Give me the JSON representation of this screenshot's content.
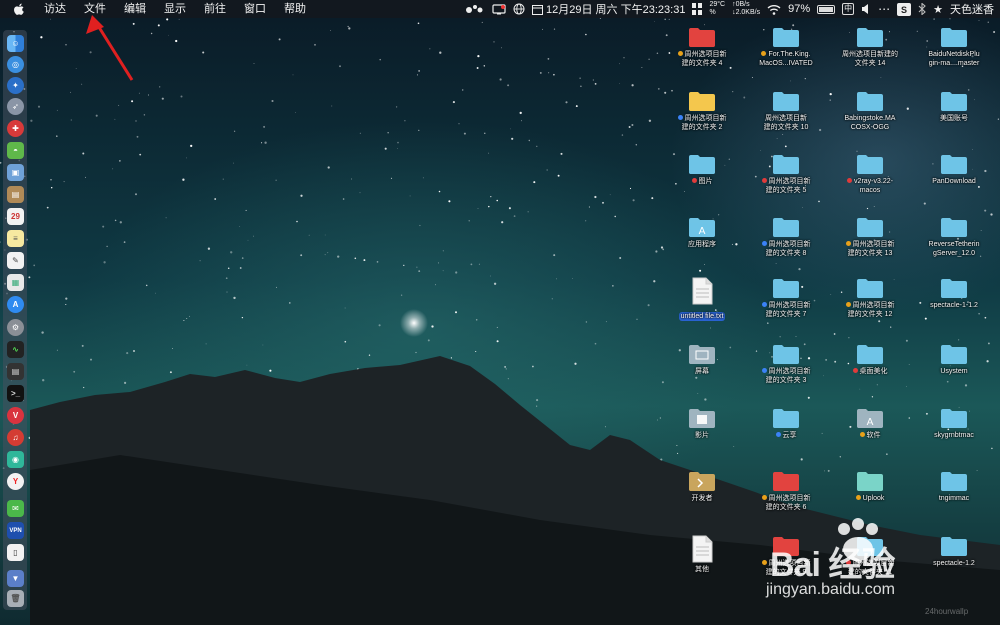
{
  "menubar": {
    "apple_icon": "apple-icon",
    "menus": [
      "访达",
      "文件",
      "编辑",
      "显示",
      "前往",
      "窗口",
      "帮助"
    ],
    "network_speed": {
      "up": "↑0B/s",
      "down": "↓2.0KB/s"
    },
    "temperature": "29°C",
    "temperature_sub": "%",
    "datetime": "12月29日 周六 下午23:23:31",
    "battery_percent": "97%",
    "battery_level": 0.97,
    "input_method": "中",
    "user_name": "天色迷香"
  },
  "desktop_icons": [
    {
      "label": "周州选项目新\n建的文件夹 4",
      "kind": "folder-red",
      "tag": "#e8a11a"
    },
    {
      "label": "For.The.King.\nMacOS...IVATED",
      "kind": "folder",
      "tag": "#e8a11a"
    },
    {
      "label": "周州选项目新建的\n文件夹 14",
      "kind": "folder",
      "tag": ""
    },
    {
      "label": "BaiduNetdiskPlu\ngin-ma....master",
      "kind": "folder",
      "tag": ""
    },
    {
      "label": "周州选项目新\n建的文件夹 2",
      "kind": "folder-yellow",
      "tag": "#3b82f6"
    },
    {
      "label": "周州选项目新\n建的文件夹 10",
      "kind": "folder",
      "tag": ""
    },
    {
      "label": "Babingstoke.MA\nCOSX-OGG",
      "kind": "folder",
      "tag": ""
    },
    {
      "label": "美国账号",
      "kind": "folder",
      "tag": ""
    },
    {
      "label": "图片",
      "kind": "folder",
      "tag": "#e03b3b"
    },
    {
      "label": "周州选项目新\n建的文件夹 5",
      "kind": "folder",
      "tag": "#e03b3b"
    },
    {
      "label": "v2ray-v3.22-\nmacos",
      "kind": "folder",
      "tag": "#e03b3b"
    },
    {
      "label": "PanDownload",
      "kind": "folder",
      "tag": ""
    },
    {
      "label": "应用程序",
      "kind": "app-folder",
      "tag": ""
    },
    {
      "label": "周州选项目新\n建的文件夹 8",
      "kind": "folder",
      "tag": "#3b82f6"
    },
    {
      "label": "周州选项目新\n建的文件夹 13",
      "kind": "folder",
      "tag": "#e8a11a"
    },
    {
      "label": "ReverseTetherin\ngServer_12.0",
      "kind": "folder",
      "tag": ""
    },
    {
      "label": "untitled file.txt",
      "kind": "text-file",
      "tag": "",
      "selected": true
    },
    {
      "label": "周州选项目新\n建的文件夹 7",
      "kind": "folder",
      "tag": "#3b82f6"
    },
    {
      "label": "周州选项目新\n建的文件夹 12",
      "kind": "folder",
      "tag": "#e8a11a"
    },
    {
      "label": "spectacle-1-1.2",
      "kind": "folder",
      "tag": ""
    },
    {
      "label": "屏幕",
      "kind": "screen-folder",
      "tag": ""
    },
    {
      "label": "周州选项目新\n建的文件夹 3",
      "kind": "folder",
      "tag": "#3b82f6"
    },
    {
      "label": "桌面美化",
      "kind": "folder",
      "tag": "#e03b3b"
    },
    {
      "label": "Usystem",
      "kind": "folder",
      "tag": ""
    },
    {
      "label": "影片",
      "kind": "movie-folder",
      "tag": ""
    },
    {
      "label": "云享",
      "kind": "folder",
      "tag": "#3b82f6"
    },
    {
      "label": "软件",
      "kind": "app-folder-gray",
      "tag": "#e8a11a"
    },
    {
      "label": "skygrnbtmac",
      "kind": "folder",
      "tag": ""
    },
    {
      "label": "开发者",
      "kind": "dev-folder",
      "tag": ""
    },
    {
      "label": "周州选项目新\n建的文件夹 6",
      "kind": "folder-red",
      "tag": "#e8a11a"
    },
    {
      "label": "Uplook",
      "kind": "folder-teal",
      "tag": "#e8a11a"
    },
    {
      "label": "tngimmac",
      "kind": "folder",
      "tag": ""
    },
    {
      "label": "其他",
      "kind": "doc-file",
      "tag": ""
    },
    {
      "label": "周州选项目新\n建的文件夹 9",
      "kind": "folder-red",
      "tag": "#e8a11a"
    },
    {
      "label": "周州选项目新\n建的文件夹 11",
      "kind": "folder",
      "tag": "#e03b3b"
    },
    {
      "label": "spectacle-1.2",
      "kind": "folder",
      "tag": ""
    }
  ],
  "watermark": {
    "brand": "Bai 经验",
    "url": "jingyan.baidu.com",
    "credit": "24hourwallp"
  },
  "colors": {
    "menubar": "#14181e",
    "folder": "#6fc4e6",
    "folder_red": "#e2433f",
    "folder_yellow": "#f3c74d",
    "selection": "#2a63d2",
    "arrow": "#e02020"
  }
}
